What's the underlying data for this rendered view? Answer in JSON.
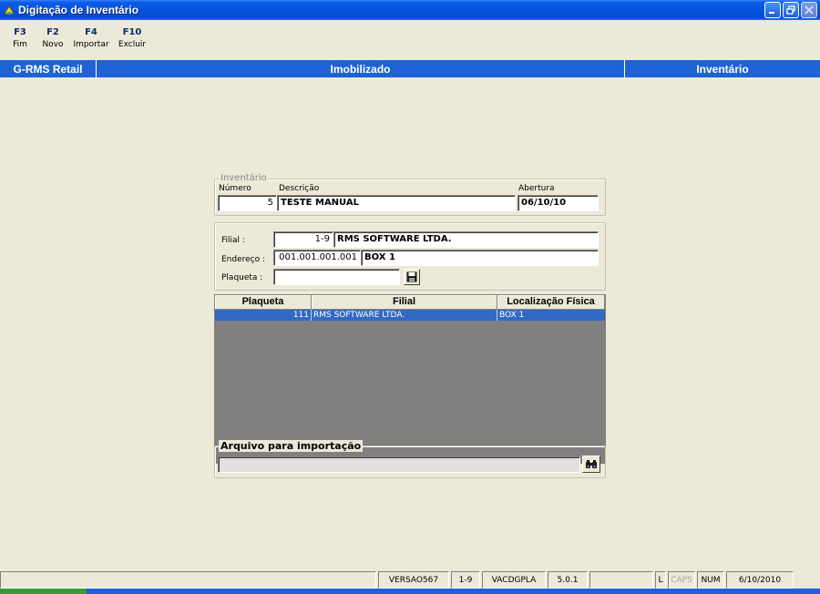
{
  "window": {
    "title": "Digitação de Inventário",
    "icon": "app-icon"
  },
  "toolbar": [
    {
      "key": "F3",
      "label": "Fim"
    },
    {
      "key": "F2",
      "label": "Novo"
    },
    {
      "key": "F4",
      "label": "Importar"
    },
    {
      "key": "F10",
      "label": "Excluir"
    }
  ],
  "band": {
    "left": "G-RMS Retail",
    "middle": "Imobilizado",
    "right": "Inventário"
  },
  "inventario": {
    "legend": "Inventário",
    "numero_label": "Número",
    "numero_value": "5",
    "descricao_label": "Descrição",
    "descricao_value": "TESTE MANUAL",
    "abertura_label": "Abertura",
    "abertura_value": "06/10/10"
  },
  "filial_group": {
    "filial_label": "Filial :",
    "filial_code": "1-9",
    "filial_name": "RMS SOFTWARE LTDA.",
    "endereco_label": "Endereço :",
    "endereco_code": "001.001.001.001",
    "endereco_name": "BOX 1",
    "plaqueta_label": "Plaqueta :",
    "plaqueta_value": "",
    "save_icon": "floppy-disk-icon"
  },
  "grid": {
    "columns": [
      "Plaqueta",
      "Filial",
      "Localização Física"
    ],
    "rows": [
      {
        "plaqueta": "111",
        "filial": "RMS SOFTWARE LTDA.",
        "localizacao": "BOX 1"
      }
    ]
  },
  "importacao": {
    "legend": "Arquivo para importação",
    "path_value": "",
    "browse_icon": "binoculars-icon"
  },
  "statusbar": {
    "version": "VERSAO567",
    "filial": "1-9",
    "program": "VACDGPLA",
    "release": "5.0.1",
    "l": "L",
    "caps": "CAPS",
    "num": "NUM",
    "date": "6/10/2010"
  },
  "colors": {
    "band": "#1E62D6",
    "selection": "#316AC5",
    "grid_bg": "#808080"
  }
}
